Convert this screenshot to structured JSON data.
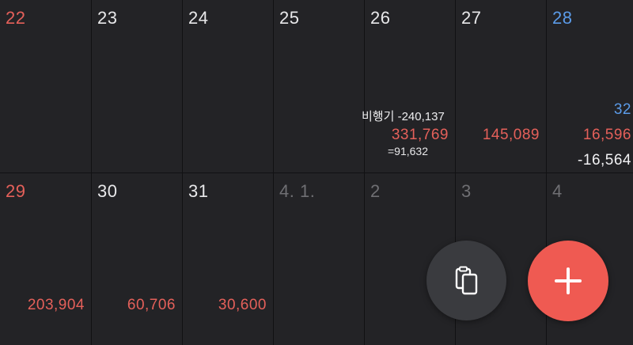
{
  "week1": {
    "d22": {
      "day": "22"
    },
    "d23": {
      "day": "23"
    },
    "d24": {
      "day": "24"
    },
    "d25": {
      "day": "25"
    },
    "d26": {
      "day": "26",
      "memo": "비행기 -240,137",
      "expense": "331,769",
      "total": "=91,632"
    },
    "d27": {
      "day": "27",
      "expense": "145,089"
    },
    "d28": {
      "day": "28",
      "income": "32",
      "expense": "16,596",
      "total": "-16,564"
    }
  },
  "week2": {
    "d29": {
      "day": "29",
      "expense": "203,904"
    },
    "d30": {
      "day": "30",
      "expense": "60,706"
    },
    "d31": {
      "day": "31",
      "expense": "30,600"
    },
    "n1": {
      "day": "4. 1."
    },
    "n2": {
      "day": "2"
    },
    "n3": {
      "day": "3"
    },
    "n4": {
      "day": "4"
    }
  },
  "colors": {
    "background": "#232326",
    "expense": "#e5605a",
    "sunday": "#e5605a",
    "saturday": "#5b9be8",
    "fab_add": "#ef5a52",
    "fab_copy": "#3a3b3f"
  },
  "icons": {
    "copy": "copy-icon",
    "add": "plus-icon"
  }
}
